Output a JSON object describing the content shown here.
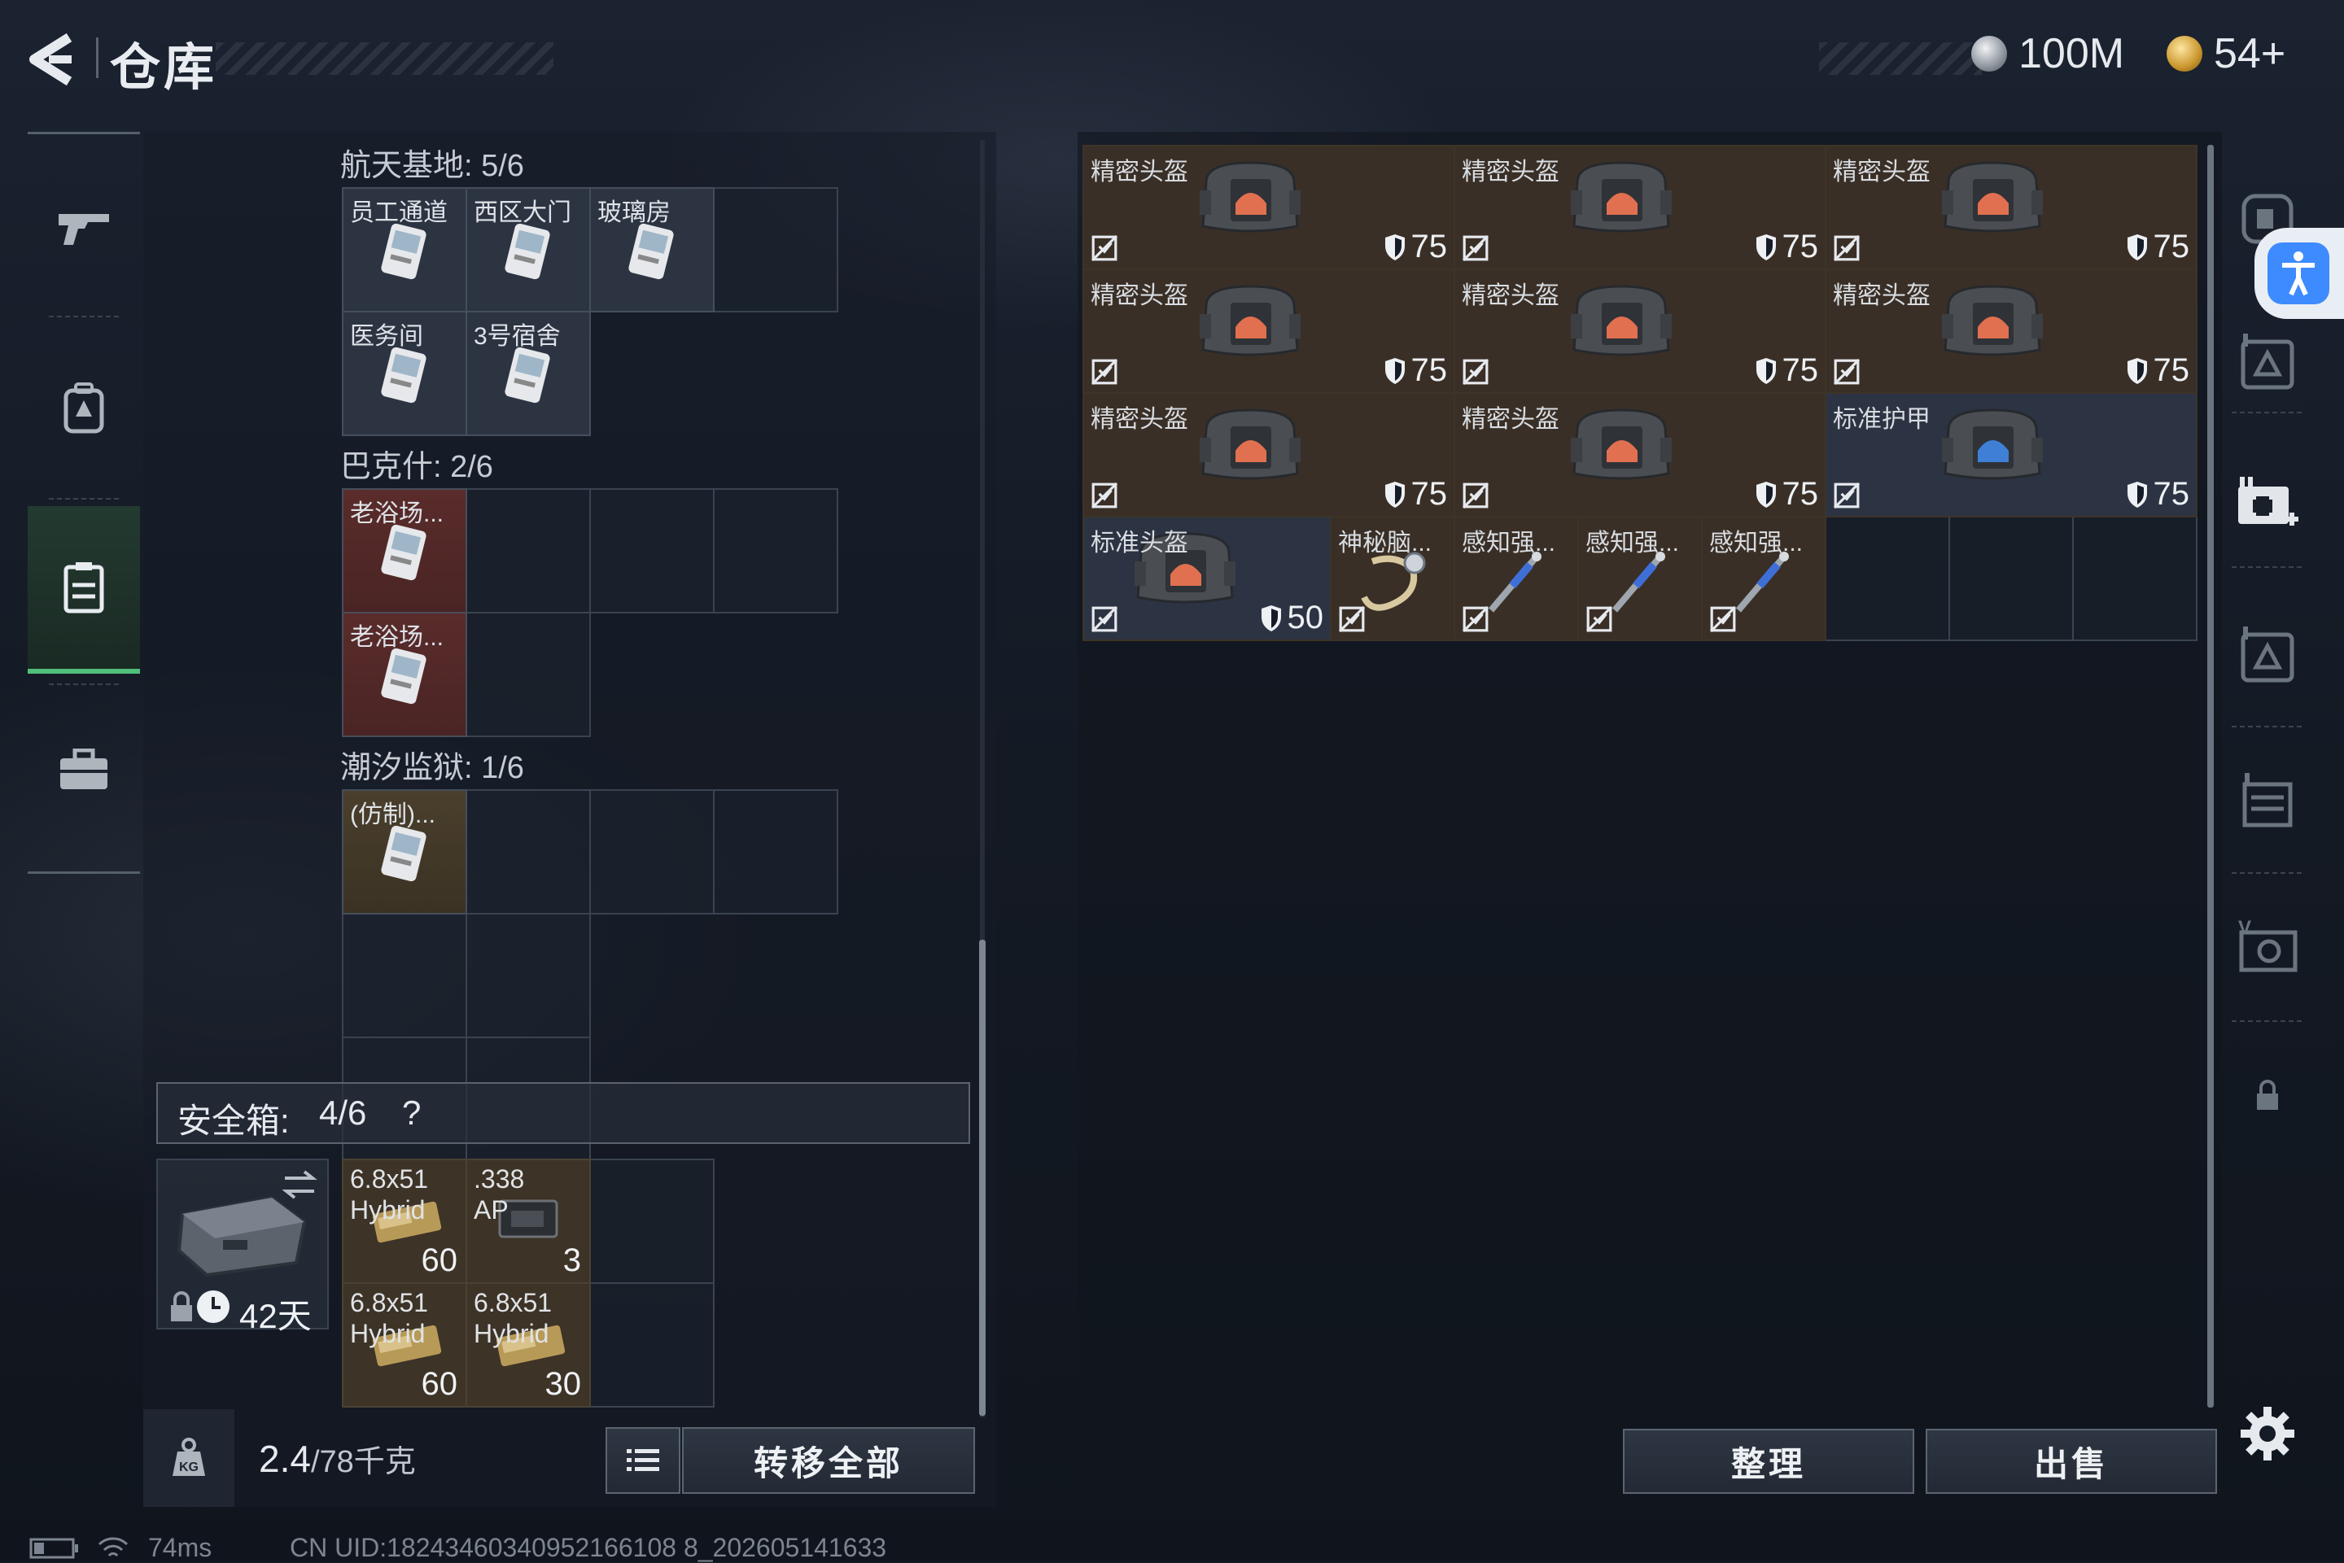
{
  "header": {
    "title": "仓库",
    "currency_a": "100M",
    "currency_b": "54+"
  },
  "key_groups": [
    {
      "label": "航天基地: 5/6",
      "keys": [
        "员工通道",
        "西区大门",
        "玻璃房",
        "医务间",
        "3号宿舍"
      ]
    },
    {
      "label": "巴克什: 2/6",
      "keys": [
        "老浴场...",
        "老浴场..."
      ]
    },
    {
      "label": "潮汐监狱: 1/6",
      "keys": [
        "(仿制)..."
      ]
    }
  ],
  "safebox": {
    "label": "安全箱:",
    "count": "4/6",
    "help": "?",
    "duration": "42天",
    "ammo": [
      {
        "name1": "6.8x51",
        "name2": "Hybrid",
        "count": "60"
      },
      {
        "name1": ".338",
        "name2": "AP",
        "count": "3"
      },
      {
        "name1": "6.8x51",
        "name2": "Hybrid",
        "count": "60"
      },
      {
        "name1": "6.8x51",
        "name2": "Hybrid",
        "count": "30"
      }
    ]
  },
  "weight": {
    "current": "2.4",
    "max": "/78千克"
  },
  "buttons": {
    "transfer_all": "转移全部",
    "organize": "整理",
    "sell": "出售"
  },
  "stash_items": [
    {
      "name": "精密头盔",
      "armor": "75"
    },
    {
      "name": "精密头盔",
      "armor": "75"
    },
    {
      "name": "精密头盔",
      "armor": "75"
    },
    {
      "name": "精密头盔",
      "armor": "75"
    },
    {
      "name": "精密头盔",
      "armor": "75"
    },
    {
      "name": "精密头盔",
      "armor": "75"
    },
    {
      "name": "精密头盔",
      "armor": "75"
    },
    {
      "name": "精密头盔",
      "armor": "75"
    },
    {
      "name": "标准护甲",
      "armor": "75"
    },
    {
      "name": "标准头盔",
      "armor": "50"
    },
    {
      "name": "神秘脑...",
      "armor": ""
    },
    {
      "name": "感知强...",
      "armor": ""
    },
    {
      "name": "感知强...",
      "armor": ""
    },
    {
      "name": "感知强...",
      "armor": ""
    }
  ],
  "status_bar": {
    "ping": "74ms",
    "uid": "CN UID:18243460340952166108 8_202605141633"
  },
  "colors": {
    "active_tab": "#4fbf7a",
    "accessibility_button": "#3d8bff"
  }
}
